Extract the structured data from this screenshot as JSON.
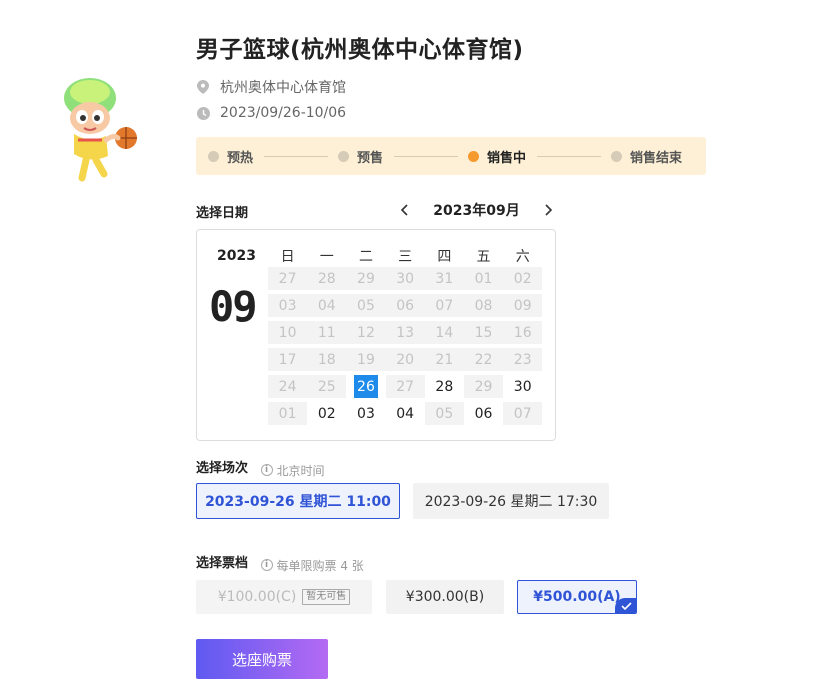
{
  "event": {
    "title": "男子篮球(杭州奥体中心体育馆)",
    "venue": "杭州奥体中心体育馆",
    "date_range": "2023/09/26-10/06"
  },
  "status_steps": [
    {
      "label": "预热",
      "active": false
    },
    {
      "label": "预售",
      "active": false
    },
    {
      "label": "销售中",
      "active": true
    },
    {
      "label": "销售结束",
      "active": false
    }
  ],
  "date_picker": {
    "label": "选择日期",
    "month_label": "2023年09月",
    "year": "2023",
    "month": "09",
    "weekdays": [
      "日",
      "一",
      "二",
      "三",
      "四",
      "五",
      "六"
    ],
    "days": [
      {
        "d": "27",
        "state": "disabled"
      },
      {
        "d": "28",
        "state": "disabled"
      },
      {
        "d": "29",
        "state": "disabled"
      },
      {
        "d": "30",
        "state": "disabled"
      },
      {
        "d": "31",
        "state": "disabled"
      },
      {
        "d": "01",
        "state": "disabled"
      },
      {
        "d": "02",
        "state": "disabled"
      },
      {
        "d": "03",
        "state": "disabled"
      },
      {
        "d": "04",
        "state": "disabled"
      },
      {
        "d": "05",
        "state": "disabled"
      },
      {
        "d": "06",
        "state": "disabled"
      },
      {
        "d": "07",
        "state": "disabled"
      },
      {
        "d": "08",
        "state": "disabled"
      },
      {
        "d": "09",
        "state": "disabled"
      },
      {
        "d": "10",
        "state": "disabled"
      },
      {
        "d": "11",
        "state": "disabled"
      },
      {
        "d": "12",
        "state": "disabled"
      },
      {
        "d": "13",
        "state": "disabled"
      },
      {
        "d": "14",
        "state": "disabled"
      },
      {
        "d": "15",
        "state": "disabled"
      },
      {
        "d": "16",
        "state": "disabled"
      },
      {
        "d": "17",
        "state": "disabled"
      },
      {
        "d": "18",
        "state": "disabled"
      },
      {
        "d": "19",
        "state": "disabled"
      },
      {
        "d": "20",
        "state": "disabled"
      },
      {
        "d": "21",
        "state": "disabled"
      },
      {
        "d": "22",
        "state": "disabled"
      },
      {
        "d": "23",
        "state": "disabled"
      },
      {
        "d": "24",
        "state": "disabled"
      },
      {
        "d": "25",
        "state": "disabled"
      },
      {
        "d": "26",
        "state": "selected"
      },
      {
        "d": "27",
        "state": "disabled"
      },
      {
        "d": "28",
        "state": "available"
      },
      {
        "d": "29",
        "state": "disabled"
      },
      {
        "d": "30",
        "state": "available"
      },
      {
        "d": "01",
        "state": "disabled"
      },
      {
        "d": "02",
        "state": "available"
      },
      {
        "d": "03",
        "state": "available"
      },
      {
        "d": "04",
        "state": "available"
      },
      {
        "d": "05",
        "state": "disabled"
      },
      {
        "d": "06",
        "state": "available"
      },
      {
        "d": "07",
        "state": "disabled"
      }
    ]
  },
  "session": {
    "label": "选择场次",
    "hint": "北京时间",
    "options": [
      "2023-09-26 星期二 11:00",
      "2023-09-26 星期二 17:30"
    ]
  },
  "tier": {
    "label": "选择票档",
    "hint": "每单限购票 4 张",
    "options": [
      {
        "price": "¥100.00(C)",
        "badge": "暂无可售"
      },
      {
        "price": "¥300.00(B)"
      },
      {
        "price": "¥500.00(A)"
      }
    ]
  },
  "buy_button": "选座购票",
  "colors": {
    "accent": "#2f54d6",
    "selected_day": "#1e8bea",
    "status_active": "#f59a2c"
  }
}
